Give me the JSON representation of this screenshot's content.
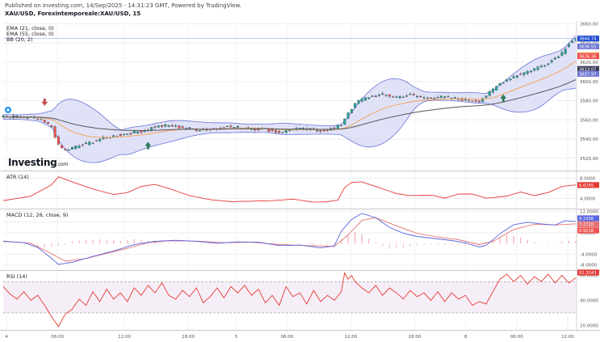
{
  "header": {
    "published": "Published on Investing.com, 14/Sep/2025 - 14:31:23 GMT, Powered by TradingView.",
    "symbol": "XAU/USD, Forexintemporeale:XAU/USD, 15"
  },
  "indicators": [
    "EMA (21, close, 0)",
    "EMA (55, close, 0)",
    "BB (20, 2)"
  ],
  "logo": {
    "text": "Investing",
    "suffix": ".com"
  },
  "colors": {
    "up": "#26a69a",
    "down": "#ef5350",
    "ema21": "#f5a35c",
    "ema55": "#555555",
    "bb_fill": "#d6d8f5",
    "bb_line": "#6b73d8",
    "atr": "#e53935",
    "macd": "#5965e0",
    "signal": "#e57373",
    "rsi": "#e53935",
    "rsi_band": "#f6eef6",
    "last_price": "#1e4cd2",
    "grid": "#eeeeee"
  },
  "chart_data": [
    {
      "type": "candlestick",
      "name": "main",
      "x_tick_labels": [
        "4",
        "06:00",
        "12:00",
        "18:00",
        "5",
        "06:00",
        "12:00",
        "18:00",
        "8",
        "06:00",
        "12:00"
      ],
      "y_ticks": [
        3520,
        3540,
        3560,
        3580,
        3600,
        3620,
        3640,
        3660
      ],
      "ylim": [
        3508,
        3663
      ],
      "price_tags": [
        {
          "label": "3644.74",
          "value": 3644.74,
          "color": "#1e4cd2"
        },
        {
          "label": "3636.55",
          "value": 3636.55,
          "color": "#7078d8"
        },
        {
          "label": "3627.41",
          "value": 3627.41,
          "color": "#f5a35c"
        },
        {
          "label": "3626.36",
          "value": 3626.36,
          "color": "#ef5350"
        },
        {
          "label": "3613.07",
          "value": 3613.07,
          "color": "#3c3c5c"
        },
        {
          "label": "3607.97",
          "value": 3607.97,
          "color": "#7078d8"
        }
      ],
      "close_path": [
        [
          0,
          3563
        ],
        [
          5,
          3563
        ],
        [
          10,
          3561
        ],
        [
          14,
          3553
        ],
        [
          16,
          3533
        ],
        [
          18,
          3528
        ],
        [
          21,
          3532
        ],
        [
          24,
          3535
        ],
        [
          28,
          3540
        ],
        [
          32,
          3543
        ],
        [
          36,
          3546
        ],
        [
          40,
          3548
        ],
        [
          44,
          3553
        ],
        [
          48,
          3554
        ],
        [
          52,
          3552
        ],
        [
          56,
          3550
        ],
        [
          60,
          3550
        ],
        [
          64,
          3553
        ],
        [
          68,
          3552
        ],
        [
          72,
          3551
        ],
        [
          76,
          3550
        ],
        [
          80,
          3547
        ],
        [
          84,
          3551
        ],
        [
          88,
          3550
        ],
        [
          92,
          3549
        ],
        [
          96,
          3551
        ],
        [
          98,
          3555
        ],
        [
          100,
          3568
        ],
        [
          103,
          3580
        ],
        [
          106,
          3584
        ],
        [
          110,
          3586
        ],
        [
          114,
          3584
        ],
        [
          118,
          3586
        ],
        [
          122,
          3583
        ],
        [
          126,
          3584
        ],
        [
          130,
          3583
        ],
        [
          134,
          3581
        ],
        [
          138,
          3580
        ],
        [
          141,
          3588
        ],
        [
          144,
          3598
        ],
        [
          147,
          3604
        ],
        [
          150,
          3608
        ],
        [
          153,
          3612
        ],
        [
          156,
          3616
        ],
        [
          159,
          3622
        ],
        [
          162,
          3630
        ],
        [
          164,
          3640
        ],
        [
          166,
          3645
        ]
      ],
      "signals": [
        {
          "type": "sell",
          "index": 12
        },
        {
          "type": "buy",
          "index": 42
        },
        {
          "type": "buy",
          "index": 145
        }
      ]
    },
    {
      "type": "line",
      "name": "ATR",
      "label": "ATR (14)",
      "y_ticks": [
        4,
        8
      ],
      "ylim": [
        2.2,
        9.2
      ],
      "last_value": "6.6745",
      "series_path": [
        [
          0,
          3.6
        ],
        [
          8,
          4.5
        ],
        [
          14,
          6.7
        ],
        [
          16,
          8.3
        ],
        [
          20,
          7.3
        ],
        [
          26,
          5.9
        ],
        [
          32,
          4.8
        ],
        [
          36,
          5.2
        ],
        [
          40,
          6.4
        ],
        [
          44,
          6.8
        ],
        [
          48,
          6.0
        ],
        [
          54,
          4.6
        ],
        [
          60,
          3.8
        ],
        [
          66,
          3.4
        ],
        [
          72,
          3.5
        ],
        [
          78,
          3.6
        ],
        [
          84,
          3.9
        ],
        [
          90,
          3.3
        ],
        [
          94,
          3.4
        ],
        [
          97,
          3.7
        ],
        [
          99,
          6.2
        ],
        [
          101,
          7.2
        ],
        [
          104,
          7.3
        ],
        [
          108,
          6.4
        ],
        [
          114,
          5.0
        ],
        [
          118,
          4.6
        ],
        [
          124,
          4.7
        ],
        [
          128,
          4.1
        ],
        [
          132,
          4.9
        ],
        [
          136,
          4.9
        ],
        [
          140,
          4.1
        ],
        [
          142,
          4.2
        ],
        [
          146,
          4.5
        ],
        [
          150,
          5.3
        ],
        [
          154,
          4.6
        ],
        [
          158,
          5.2
        ],
        [
          162,
          6.4
        ],
        [
          166,
          6.7
        ]
      ]
    },
    {
      "type": "macd",
      "name": "MACD",
      "label": "MACD (12, 26, close, 9)",
      "y_ticks": [
        -8,
        -4,
        4,
        8,
        12
      ],
      "ylim": [
        -9.6,
        12.4
      ],
      "last_values": [
        "8.1936",
        "7.2720",
        "0.9216"
      ],
      "macd_path": [
        [
          0,
          0.8
        ],
        [
          6,
          0.3
        ],
        [
          10,
          -1.5
        ],
        [
          14,
          -5.5
        ],
        [
          16,
          -7.8
        ],
        [
          20,
          -7.0
        ],
        [
          26,
          -4.8
        ],
        [
          32,
          -2.8
        ],
        [
          38,
          -0.4
        ],
        [
          44,
          0.8
        ],
        [
          50,
          1.2
        ],
        [
          56,
          0.8
        ],
        [
          62,
          0.1
        ],
        [
          68,
          0.6
        ],
        [
          74,
          0.5
        ],
        [
          80,
          -0.8
        ],
        [
          86,
          -0.6
        ],
        [
          92,
          -1.6
        ],
        [
          96,
          -0.9
        ],
        [
          98,
          4.5
        ],
        [
          101,
          9.0
        ],
        [
          104,
          11.2
        ],
        [
          108,
          9.6
        ],
        [
          112,
          6.0
        ],
        [
          116,
          3.8
        ],
        [
          120,
          2.6
        ],
        [
          124,
          2.0
        ],
        [
          130,
          1.1
        ],
        [
          134,
          0.2
        ],
        [
          138,
          -1.3
        ],
        [
          140,
          -0.7
        ],
        [
          144,
          3.6
        ],
        [
          148,
          7.0
        ],
        [
          152,
          7.9
        ],
        [
          156,
          7.3
        ],
        [
          160,
          6.9
        ],
        [
          163,
          8.5
        ],
        [
          166,
          8.2
        ]
      ],
      "signal_path": [
        [
          0,
          0.9
        ],
        [
          8,
          0.1
        ],
        [
          14,
          -3.8
        ],
        [
          18,
          -6.6
        ],
        [
          24,
          -5.6
        ],
        [
          30,
          -3.7
        ],
        [
          36,
          -1.8
        ],
        [
          42,
          0.3
        ],
        [
          48,
          1.0
        ],
        [
          56,
          0.9
        ],
        [
          64,
          0.3
        ],
        [
          72,
          0.5
        ],
        [
          80,
          -0.4
        ],
        [
          88,
          -0.8
        ],
        [
          96,
          -1.1
        ],
        [
          100,
          3.2
        ],
        [
          104,
          8.6
        ],
        [
          108,
          9.6
        ],
        [
          114,
          6.6
        ],
        [
          120,
          3.8
        ],
        [
          126,
          2.4
        ],
        [
          132,
          1.4
        ],
        [
          138,
          -0.4
        ],
        [
          142,
          0.8
        ],
        [
          148,
          5.2
        ],
        [
          154,
          7.2
        ],
        [
          160,
          6.9
        ],
        [
          166,
          7.3
        ]
      ],
      "histogram": [
        [
          0,
          0.2
        ],
        [
          4,
          0.1
        ],
        [
          8,
          -0.6
        ],
        [
          10,
          -1.2
        ],
        [
          12,
          -1.7
        ],
        [
          14,
          -1.4
        ],
        [
          16,
          -1.0
        ],
        [
          18,
          -0.6
        ],
        [
          20,
          0.8
        ],
        [
          22,
          1.1
        ],
        [
          24,
          1.3
        ],
        [
          26,
          1.4
        ],
        [
          28,
          1.5
        ],
        [
          30,
          1.3
        ],
        [
          32,
          1.1
        ],
        [
          34,
          0.9
        ],
        [
          36,
          1.3
        ],
        [
          38,
          1.6
        ],
        [
          40,
          1.4
        ],
        [
          42,
          1.0
        ],
        [
          44,
          0.6
        ],
        [
          46,
          0.3
        ],
        [
          48,
          0.2
        ],
        [
          50,
          0.3
        ],
        [
          52,
          -0.3
        ],
        [
          54,
          -0.4
        ],
        [
          56,
          -0.2
        ],
        [
          58,
          -0.3
        ],
        [
          60,
          -0.5
        ],
        [
          62,
          -0.4
        ],
        [
          64,
          0.2
        ],
        [
          66,
          0.3
        ],
        [
          68,
          0.4
        ],
        [
          70,
          0.2
        ],
        [
          72,
          0.1
        ],
        [
          74,
          -0.1
        ],
        [
          76,
          -0.3
        ],
        [
          78,
          -0.4
        ],
        [
          80,
          -0.5
        ],
        [
          82,
          -0.3
        ],
        [
          84,
          0.3
        ],
        [
          86,
          0.2
        ],
        [
          88,
          -0.2
        ],
        [
          90,
          -0.5
        ],
        [
          92,
          -0.7
        ],
        [
          94,
          -0.4
        ],
        [
          96,
          0.2
        ],
        [
          98,
          1.5
        ],
        [
          100,
          3.0
        ],
        [
          102,
          4.2
        ],
        [
          104,
          3.4
        ],
        [
          106,
          1.8
        ],
        [
          108,
          0.4
        ],
        [
          110,
          -1.2
        ],
        [
          112,
          -2.0
        ],
        [
          114,
          -1.9
        ],
        [
          116,
          -1.6
        ],
        [
          118,
          -1.2
        ],
        [
          120,
          -0.9
        ],
        [
          122,
          -0.6
        ],
        [
          124,
          -0.5
        ],
        [
          126,
          -0.5
        ],
        [
          128,
          -0.6
        ],
        [
          130,
          -0.5
        ],
        [
          132,
          -0.7
        ],
        [
          134,
          -0.9
        ],
        [
          136,
          -1.1
        ],
        [
          138,
          -0.8
        ],
        [
          140,
          0.3
        ],
        [
          142,
          1.2
        ],
        [
          144,
          2.5
        ],
        [
          146,
          3.0
        ],
        [
          148,
          2.8
        ],
        [
          150,
          2.2
        ],
        [
          152,
          1.2
        ],
        [
          154,
          0.6
        ],
        [
          156,
          0.2
        ],
        [
          158,
          -0.3
        ],
        [
          160,
          0.2
        ],
        [
          162,
          0.8
        ],
        [
          164,
          1.0
        ],
        [
          166,
          0.9
        ]
      ]
    },
    {
      "type": "line",
      "name": "RSI",
      "label": "RSI (14)",
      "y_ticks": [
        20,
        40,
        60
      ],
      "ylim": [
        17,
        63
      ],
      "bands": [
        30,
        55
      ],
      "last_value": "62.3243",
      "series_path": [
        [
          0,
          51
        ],
        [
          2,
          45
        ],
        [
          4,
          41
        ],
        [
          6,
          47
        ],
        [
          8,
          40
        ],
        [
          10,
          44
        ],
        [
          12,
          36
        ],
        [
          14,
          27
        ],
        [
          16,
          19
        ],
        [
          18,
          29
        ],
        [
          20,
          33
        ],
        [
          22,
          41
        ],
        [
          24,
          36
        ],
        [
          26,
          47
        ],
        [
          28,
          39
        ],
        [
          30,
          49
        ],
        [
          32,
          41
        ],
        [
          34,
          46
        ],
        [
          36,
          39
        ],
        [
          38,
          50
        ],
        [
          40,
          44
        ],
        [
          42,
          52
        ],
        [
          44,
          46
        ],
        [
          46,
          54
        ],
        [
          48,
          44
        ],
        [
          50,
          41
        ],
        [
          52,
          48
        ],
        [
          54,
          43
        ],
        [
          56,
          50
        ],
        [
          58,
          38
        ],
        [
          60,
          43
        ],
        [
          62,
          50
        ],
        [
          64,
          42
        ],
        [
          66,
          51
        ],
        [
          68,
          46
        ],
        [
          70,
          52
        ],
        [
          72,
          44
        ],
        [
          74,
          49
        ],
        [
          76,
          38
        ],
        [
          78,
          44
        ],
        [
          80,
          36
        ],
        [
          82,
          51
        ],
        [
          84,
          43
        ],
        [
          86,
          46
        ],
        [
          88,
          37
        ],
        [
          90,
          48
        ],
        [
          92,
          39
        ],
        [
          94,
          44
        ],
        [
          96,
          40
        ],
        [
          98,
          47
        ],
        [
          99,
          62
        ],
        [
          100,
          57
        ],
        [
          101,
          60
        ],
        [
          102,
          55
        ],
        [
          104,
          50
        ],
        [
          106,
          46
        ],
        [
          108,
          52
        ],
        [
          110,
          44
        ],
        [
          112,
          50
        ],
        [
          114,
          46
        ],
        [
          116,
          41
        ],
        [
          118,
          48
        ],
        [
          120,
          43
        ],
        [
          122,
          46
        ],
        [
          124,
          40
        ],
        [
          126,
          47
        ],
        [
          128,
          39
        ],
        [
          130,
          46
        ],
        [
          132,
          41
        ],
        [
          134,
          44
        ],
        [
          136,
          36
        ],
        [
          138,
          39
        ],
        [
          140,
          37
        ],
        [
          142,
          47
        ],
        [
          144,
          57
        ],
        [
          146,
          61
        ],
        [
          148,
          55
        ],
        [
          150,
          60
        ],
        [
          152,
          53
        ],
        [
          154,
          59
        ],
        [
          156,
          55
        ],
        [
          158,
          61
        ],
        [
          160,
          54
        ],
        [
          162,
          60
        ],
        [
          164,
          54
        ],
        [
          166,
          58
        ]
      ]
    }
  ]
}
